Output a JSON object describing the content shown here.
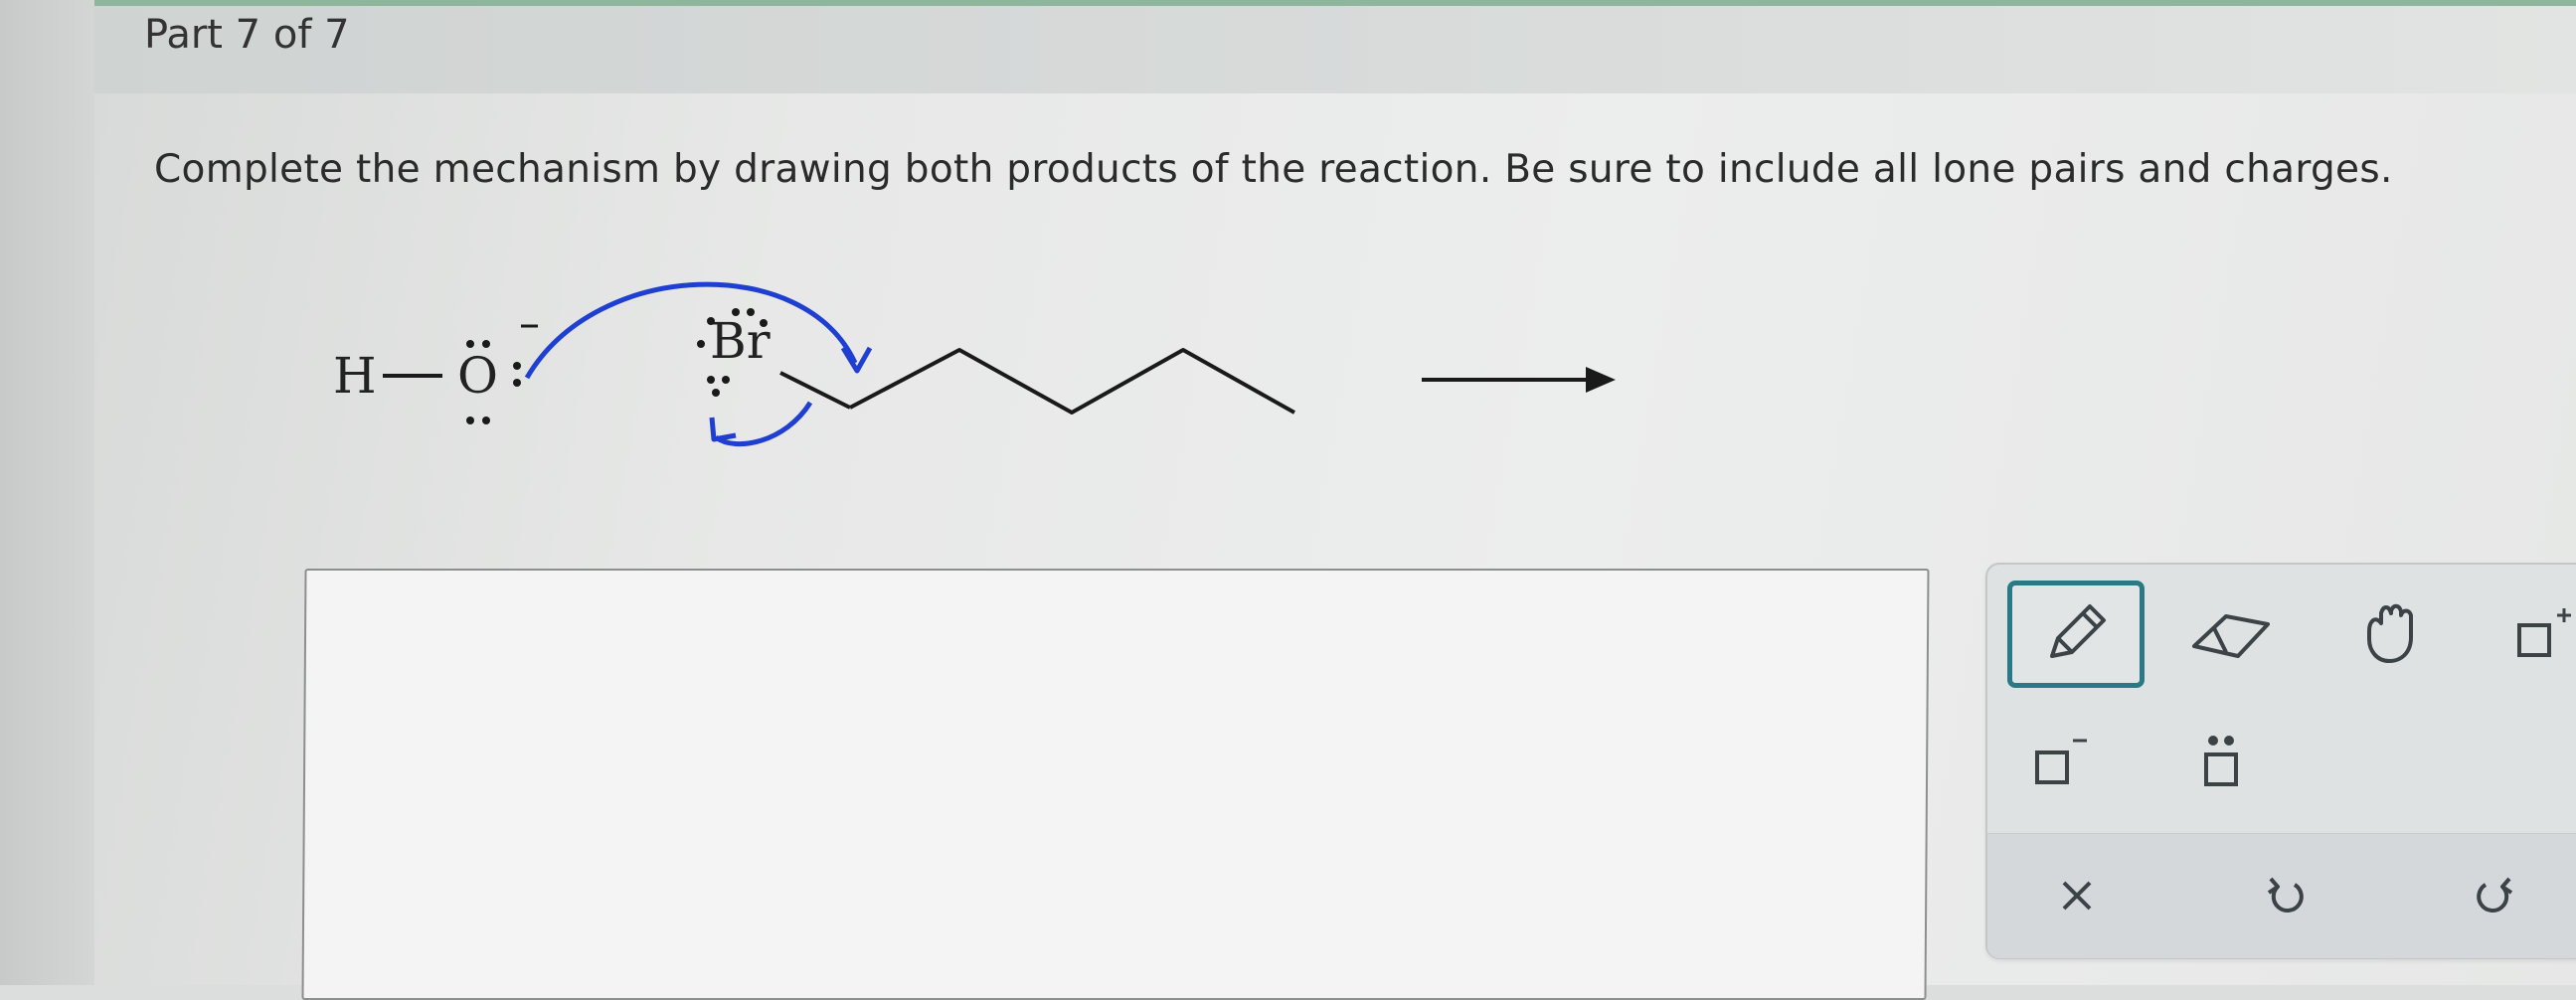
{
  "header": {
    "part_label": "Part 7 of 7"
  },
  "question": {
    "instruction": "Complete the mechanism by drawing both products of the reaction. Be sure to include all lone pairs and charges."
  },
  "mechanism": {
    "hydroxide": {
      "h_label": "H",
      "o_label": "O",
      "charge": "−"
    },
    "alkyl_bromide": {
      "br_label": "Br"
    },
    "colors": {
      "arrow": "#1f3fd1",
      "bonds": "#1a1a1a"
    }
  },
  "toolbar": {
    "tools": [
      "pencil-icon",
      "eraser-icon",
      "hand-icon",
      "add-positive-charge-icon",
      "add-negative-charge-icon",
      "add-lone-pair-icon",
      "clear-icon",
      "undo-icon",
      "redo-icon"
    ],
    "selected_tool": "pencil-icon",
    "accent_color": "#2a7a86"
  }
}
